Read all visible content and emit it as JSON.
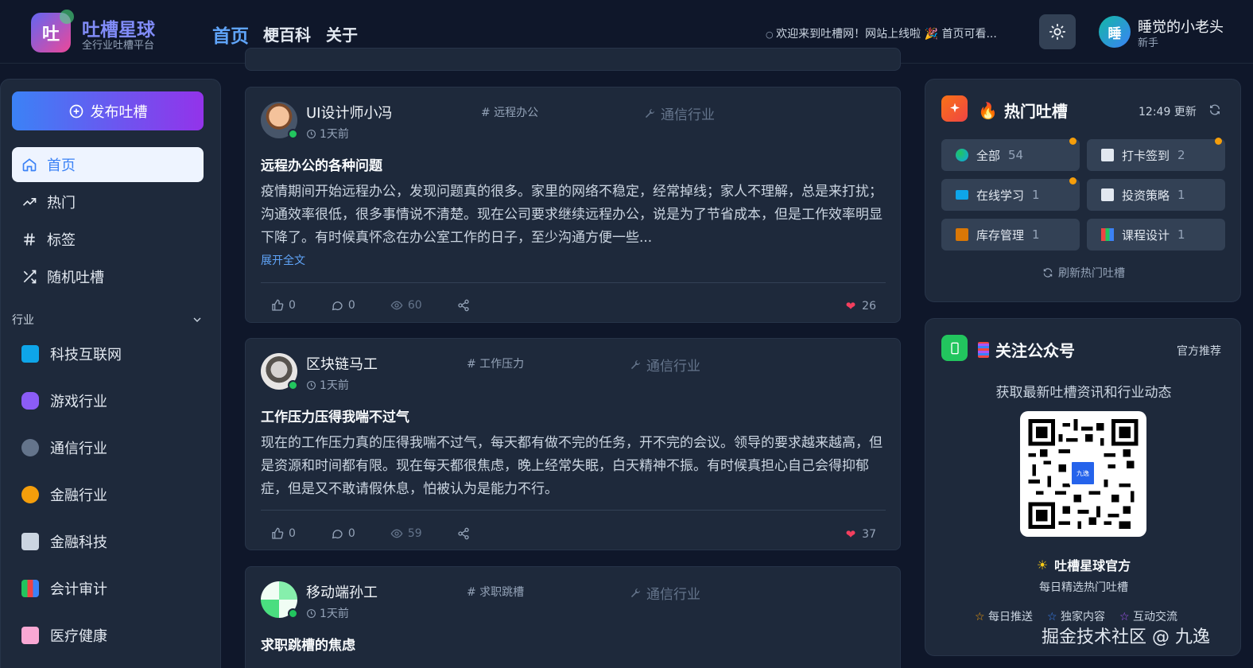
{
  "header": {
    "logo_char": "吐",
    "brand_title": "吐槽星球",
    "brand_subtitle": "全行业吐槽平台",
    "nav": [
      "首页",
      "梗百科",
      "关于"
    ],
    "marquee": "欢迎来到吐槽网！网站上线啦 🎉 首页可看...",
    "user_avatar_char": "睡",
    "user_name": "睡觉的小老头",
    "user_level": "新手"
  },
  "sidebar": {
    "publish_label": "发布吐槽",
    "menu": [
      {
        "label": "首页",
        "icon": "home-icon"
      },
      {
        "label": "热门",
        "icon": "trending-icon"
      },
      {
        "label": "标签",
        "icon": "hash-icon"
      },
      {
        "label": "随机吐槽",
        "icon": "shuffle-icon"
      }
    ],
    "section_label": "行业",
    "industries": [
      {
        "label": "科技互联网",
        "icon": "laptop-icon",
        "color": "#0ea5e9"
      },
      {
        "label": "游戏行业",
        "icon": "gamepad-icon",
        "color": "#8b5cf6"
      },
      {
        "label": "通信行业",
        "icon": "satellite-icon",
        "color": "#94a3b8"
      },
      {
        "label": "金融行业",
        "icon": "money-bag-icon",
        "color": "#f59e0b"
      },
      {
        "label": "金融科技",
        "icon": "bank-icon",
        "color": "#cbd5e1"
      },
      {
        "label": "会计审计",
        "icon": "chart-icon",
        "color": "#22c55e"
      },
      {
        "label": "医疗健康",
        "icon": "hospital-icon",
        "color": "#f472b6"
      }
    ]
  },
  "feed": [
    {
      "author": "UI设计师小冯",
      "industry": "通信行业",
      "tag": "# 远程办公",
      "time": "1天前",
      "title": "远程办公的各种问题",
      "body": "疫情期间开始远程办公，发现问题真的很多。家里的网络不稳定，经常掉线；家人不理解，总是来打扰；沟通效率很低，很多事情说不清楚。现在公司要求继续远程办公，说是为了节省成本，但是工作效率明显下降了。有时候真怀念在办公室工作的日子，至少沟通方便一些...",
      "more": "展开全文",
      "likes": "0",
      "comments": "0",
      "views": "60",
      "heat": "26"
    },
    {
      "author": "区块链马工",
      "industry": "通信行业",
      "tag": "# 工作压力",
      "time": "1天前",
      "title": "工作压力压得我喘不过气",
      "body": "现在的工作压力真的压得我喘不过气，每天都有做不完的任务，开不完的会议。领导的要求越来越高，但是资源和时间都有限。现在每天都很焦虑，晚上经常失眠，白天精神不振。有时候真担心自己会得抑郁症，但是又不敢请假休息，怕被认为是能力不行。",
      "likes": "0",
      "comments": "0",
      "views": "59",
      "heat": "37"
    },
    {
      "author": "移动端孙工",
      "industry": "通信行业",
      "tag": "# 求职跳槽",
      "time": "1天前",
      "title": "求职跳槽的焦虑"
    }
  ],
  "hot": {
    "title": "热门吐槽",
    "updated": "12:49 更新",
    "tiles": [
      {
        "label": "全部",
        "count": "54",
        "icon": "globe-icon",
        "dot": true
      },
      {
        "label": "打卡签到",
        "count": "2",
        "icon": "chart-up-icon",
        "dot": true
      },
      {
        "label": "在线学习",
        "count": "1",
        "icon": "laptop-icon",
        "dot": true
      },
      {
        "label": "投资策略",
        "count": "1",
        "icon": "chart-up-icon",
        "dot": false
      },
      {
        "label": "库存管理",
        "count": "1",
        "icon": "package-icon",
        "dot": false
      },
      {
        "label": "课程设计",
        "count": "1",
        "icon": "books-icon",
        "dot": false
      }
    ],
    "refresh": "刷新热门吐槽"
  },
  "follow": {
    "title": "关注公众号",
    "badge": "官方推荐",
    "subtitle": "获取最新吐槽资讯和行业动态",
    "qr_center": "九逸",
    "account": "吐槽星球官方",
    "account_desc": "每日精选热门吐槽",
    "features": [
      "每日推送",
      "独家内容",
      "互动交流"
    ]
  },
  "watermark": "掘金技术社区 @ 九逸",
  "colors": {
    "accent": "#3b82f6",
    "bg": "#0f172a",
    "card": "#1e293b",
    "online": "#22c55e"
  }
}
